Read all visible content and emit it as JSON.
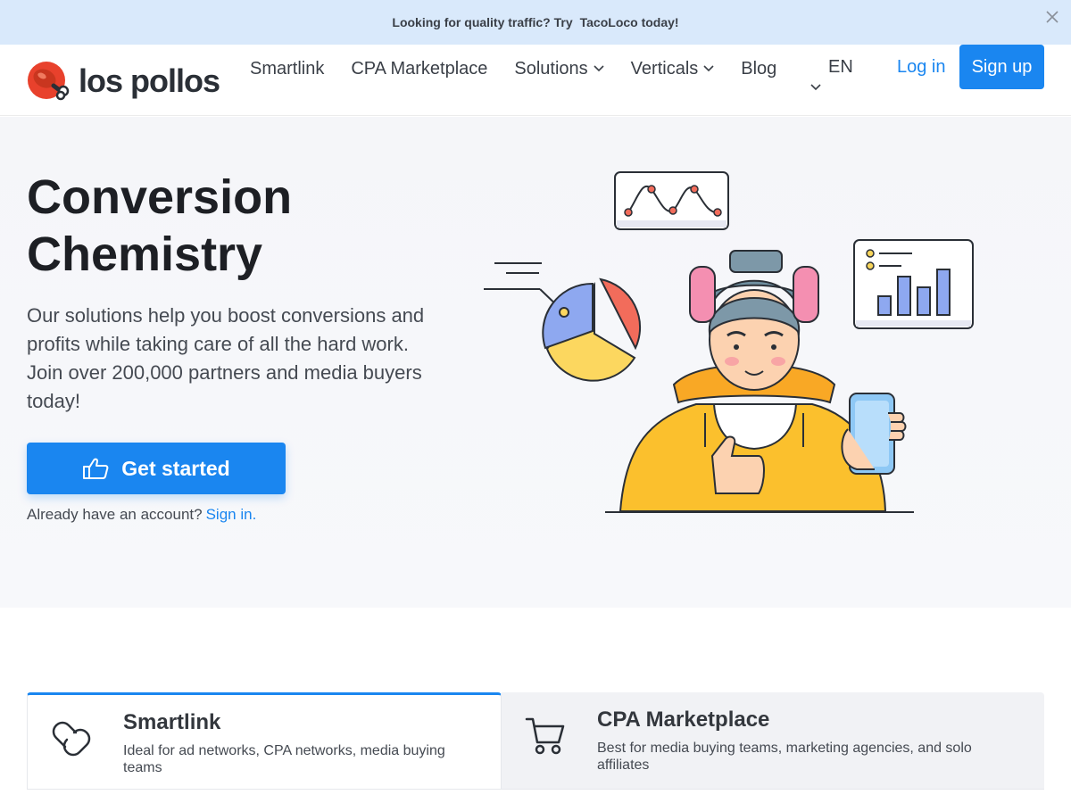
{
  "promo": {
    "text": "Looking for quality traffic? Try",
    "brand": "TacoLoco today!"
  },
  "header": {
    "logo_text": "los pollos",
    "nav": [
      {
        "label": "Smartlink"
      },
      {
        "label": "CPA Marketplace"
      },
      {
        "label": "Solutions"
      },
      {
        "label": "Verticals"
      },
      {
        "label": "Blog"
      }
    ],
    "language": "EN",
    "login_label": "Log in",
    "signup_label": "Sign up"
  },
  "hero": {
    "title_line1": "Conversion",
    "title_line2": "Chemistry",
    "subtitle": "Our solutions help you boost conversions and profits while taking care of all the hard work. Join over 200,000 partners and media buyers today!",
    "cta_label": "Get started",
    "account_prompt": "Already have an account?",
    "signin_label": "Sign in."
  },
  "tabs": [
    {
      "title": "Smartlink",
      "description": "Ideal for ad networks, CPA networks, media buying teams",
      "icon": "link-icon",
      "active": true
    },
    {
      "title": "CPA Marketplace",
      "description": "Best for media buying teams, marketing agencies, and solo affiliates",
      "icon": "shopping-cart-icon",
      "active": false
    }
  ],
  "colors": {
    "accent": "#1a86f0",
    "promo_bg": "#d9e9fb",
    "logo_red": "#e8412c"
  }
}
